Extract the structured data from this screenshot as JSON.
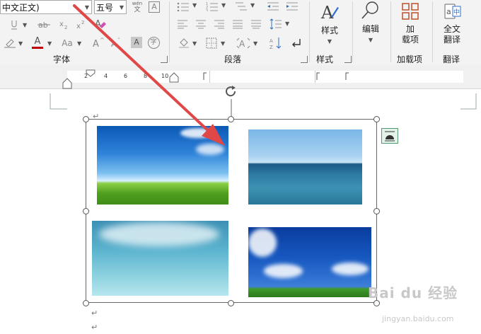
{
  "ribbon": {
    "font_name": "中文正文)",
    "font_size": "五号",
    "wen_label": "wén",
    "wen_char": "文",
    "font_color_letter": "A",
    "case_label": "Aa",
    "enclose_char": "字",
    "shade_char": "A",
    "style_big_letter": "A",
    "groups": {
      "font": "字体",
      "paragraph": "段落",
      "styles": "样式",
      "addins": "加载项",
      "translate": "翻译"
    },
    "buttons": {
      "styles": "样式",
      "editing": "编辑",
      "addins_line1": "加",
      "addins_line2": "载项",
      "translate_line1": "全文",
      "translate_line2": "翻译"
    },
    "accent_color": "#c00000"
  },
  "ruler": {
    "numbers": [
      "2",
      "4",
      "6",
      "8",
      "10"
    ]
  },
  "document": {
    "paragraph_mark": "↵"
  },
  "watermark": {
    "brand": "Bai du 经验",
    "url": "jingyan.baidu.com"
  },
  "annotation": {
    "arrow_color": "#e04848"
  }
}
